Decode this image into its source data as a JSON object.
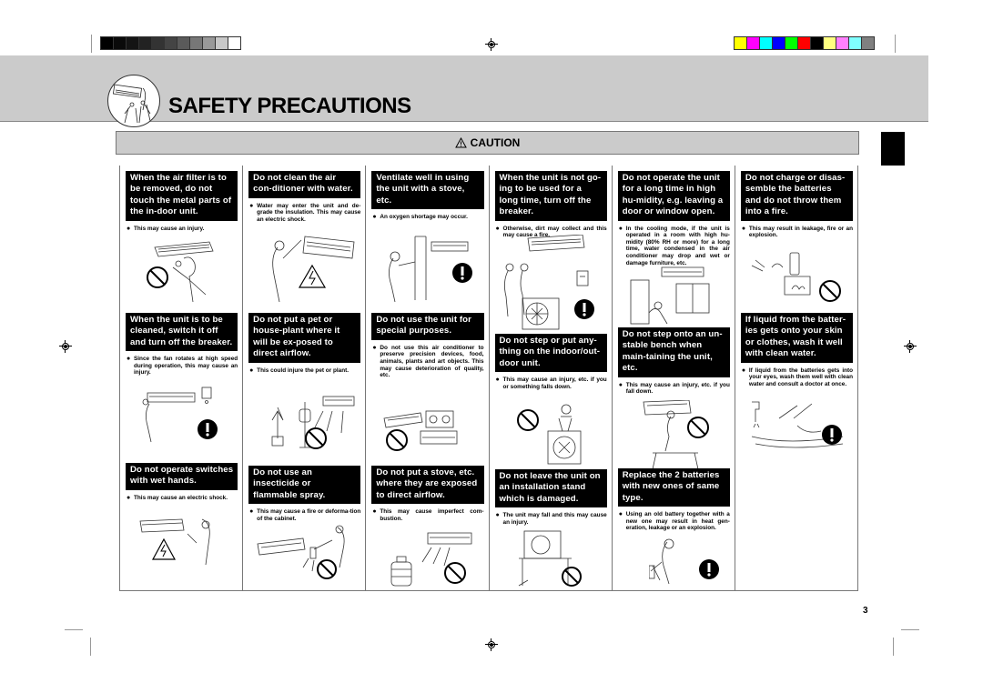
{
  "header": {
    "title": "SAFETY PRECAUTIONS",
    "caution_label": "CAUTION",
    "caution_icon": "warning-triangle-icon"
  },
  "color_bars": {
    "grayscale": [
      "#000000",
      "#0a0a0a",
      "#141414",
      "#222222",
      "#333333",
      "#444444",
      "#5a5a5a",
      "#777777",
      "#999999",
      "#c8c8c8",
      "#ffffff"
    ],
    "process": [
      "#ffff00",
      "#ff00ff",
      "#00ffff",
      "#0000ff",
      "#00ff00",
      "#ff0000",
      "#000000",
      "#ffff80",
      "#ff80ff",
      "#80ffff",
      "#808080"
    ]
  },
  "columns": [
    {
      "sections": [
        {
          "heading": "When the air filter is to be removed, do not touch the metal parts of the in-door unit.",
          "note": "This may cause an injury.",
          "icon": "prohibited-icon"
        },
        {
          "heading": "When the unit is to be cleaned, switch it off and turn off the breaker.",
          "note": "Since the fan rotates at high speed during operation, this may cause an injury.",
          "icon": "mandatory-icon"
        },
        {
          "heading": "Do not operate switches with wet hands.",
          "note": "This may cause an electric shock.",
          "icon": "electric-hazard-icon"
        }
      ]
    },
    {
      "sections": [
        {
          "heading": "Do not clean the air con-ditioner with water.",
          "note": "Water may enter the unit and de-grade the insulation. This may cause an electric shock.",
          "icon": "electric-hazard-icon"
        },
        {
          "heading": "Do not put a pet or house-plant where it will be ex-posed to direct airflow.",
          "note": "This could injure the pet or plant.",
          "icon": "prohibited-icon"
        },
        {
          "heading": "Do not use an insecticide or flammable spray.",
          "note": "This may cause a fire or deforma-tion of the cabinet.",
          "icon": "prohibited-icon"
        }
      ]
    },
    {
      "sections": [
        {
          "heading": "Ventilate well in using the unit with a stove, etc.",
          "note": "An oxygen shortage may occur.",
          "icon": "mandatory-icon"
        },
        {
          "heading": "Do not use the unit for special purposes.",
          "note": "Do not use this air conditioner to preserve precision devices, food, animals, plants and art objects. This may cause deterioration of quality, etc.",
          "icon": "prohibited-icon"
        },
        {
          "heading": "Do not put a stove, etc. where they are exposed to direct airflow.",
          "note": "This may cause imperfect com-bustion.",
          "icon": "prohibited-icon"
        }
      ]
    },
    {
      "sections": [
        {
          "heading": "When the unit is not go-ing to be used for a long time, turn off the breaker.",
          "note": "Otherwise, dirt may collect and this may cause a fire.",
          "icon": "mandatory-icon"
        },
        {
          "heading": "Do not step or put any-thing on the indoor/out-door unit.",
          "note": "This may cause an injury, etc. if you or something falls down.",
          "icon": "prohibited-icon"
        },
        {
          "heading": "Do not leave the unit on an installation stand which is damaged.",
          "note": "The unit may fall and this may cause an injury.",
          "icon": "prohibited-icon"
        }
      ]
    },
    {
      "sections": [
        {
          "heading": "Do not operate the unit for a long time in high hu-midity, e.g. leaving a door or window open.",
          "note": "In the cooling mode, if the unit is operated in a room with high hu-midity (80% RH or more) for a long time, water condensed in the air conditioner may drop and wet or damage furniture, etc.",
          "icon": "prohibited-icon"
        },
        {
          "heading": "Do not step onto an un-stable bench when main-taining the unit, etc.",
          "note": "This may cause an injury, etc. if you fall down.",
          "icon": "prohibited-icon"
        },
        {
          "heading": "Replace the 2 batteries with new ones of same type.",
          "note": "Using an old battery together with a new one may result in heat gen-eration, leakage or an explosion.",
          "icon": "mandatory-icon"
        }
      ]
    },
    {
      "sections": [
        {
          "heading": "Do not charge or disas-semble the batteries and do not throw them into a fire.",
          "note": "This may result in leakage, fire or an explosion.",
          "icon": "prohibited-icon"
        },
        {
          "heading": "If liquid from the batter-ies gets onto your skin or clothes, wash it well with clean water.",
          "note": "If liquid from the batteries gets into your eyes, wash them well with clean water and consult a doctor at once.",
          "icon": "mandatory-icon"
        }
      ]
    }
  ],
  "page_number": "3"
}
